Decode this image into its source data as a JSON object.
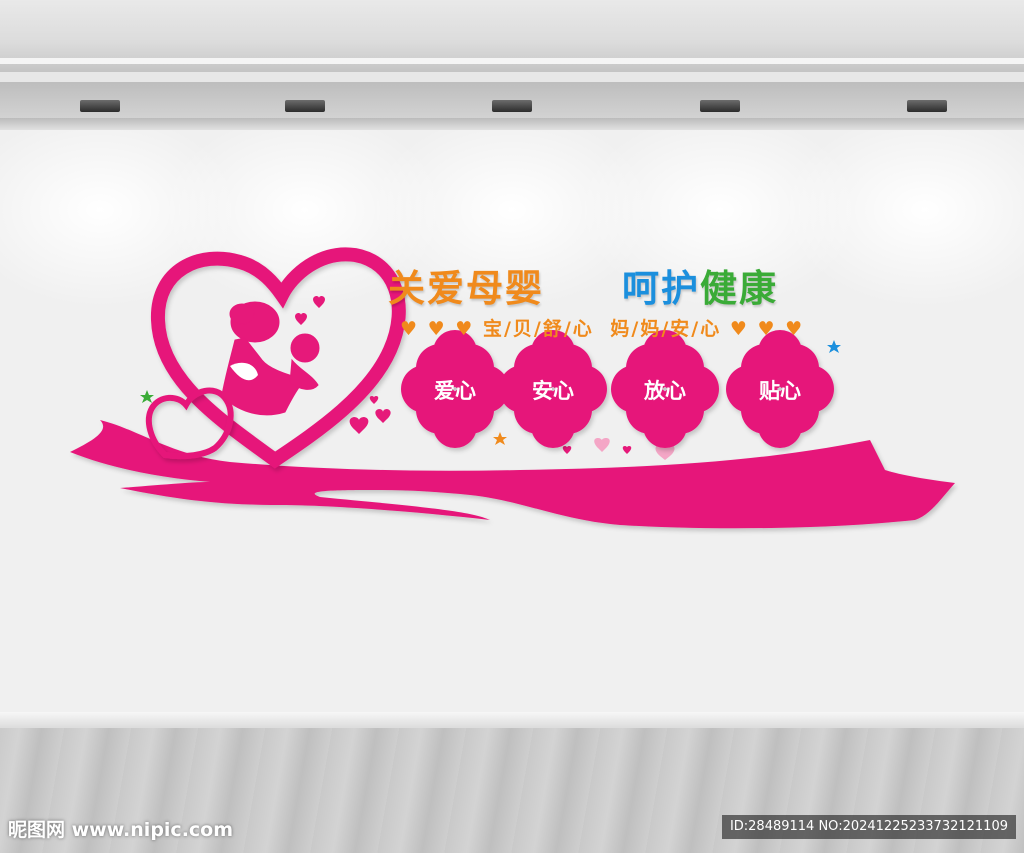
{
  "headline": {
    "left": "关爱母婴",
    "right_part1": "呵护",
    "right_part2": "健康"
  },
  "subline": {
    "left_hearts": "♥ ♥ ♥",
    "text1": "宝/贝/舒/心",
    "text2": "妈/妈/安/心",
    "right_hearts": "♥ ♥ ♥"
  },
  "flowers": [
    "爱心",
    "安心",
    "放心",
    "贴心"
  ],
  "watermark": {
    "left": "昵图网 www.nipic.com",
    "right": "ID:28489114 NO:20241225233732121109"
  },
  "colors": {
    "primary_pink": "#e6197a",
    "orange": "#f08a1c",
    "blue": "#1b8fdd",
    "green": "#3aab37"
  }
}
